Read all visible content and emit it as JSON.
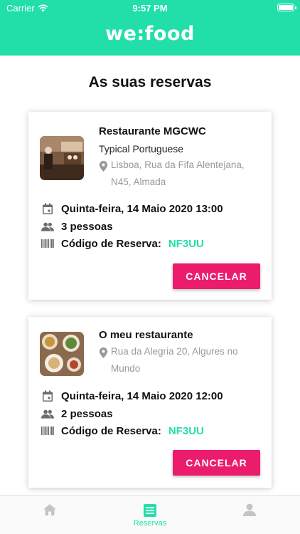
{
  "status_bar": {
    "carrier": "Carrier",
    "time": "9:57 PM"
  },
  "header": {
    "logo": "we:food"
  },
  "page": {
    "title": "As suas reservas"
  },
  "reservations": [
    {
      "restaurant": "Restaurante MGCWC",
      "cuisine": "Typical Portuguese",
      "address_line1": "Lisboa, Rua da Fifa Alentejana,",
      "address_line2": "N45, Almada",
      "datetime": "Quinta-feira, 14 Maio 2020 13:00",
      "people": "3 pessoas",
      "code_label": "Código de Reserva:",
      "code": "NF3UU",
      "cancel_label": "CANCELAR"
    },
    {
      "restaurant": "O meu restaurante",
      "address_line1": "Rua da Alegria 20, Algures no",
      "address_line2": "Mundo",
      "datetime": "Quinta-feira, 14 Maio 2020 12:00",
      "people": "2 pessoas",
      "code_label": "Código de Reserva:",
      "code": "NF3UU",
      "cancel_label": "CANCELAR"
    }
  ],
  "tabbar": {
    "items": [
      {
        "icon": "home-icon",
        "active": false
      },
      {
        "icon": "reservations-icon",
        "label": "Reservas",
        "active": true
      },
      {
        "icon": "profile-icon",
        "active": false
      }
    ]
  },
  "colors": {
    "brand": "#22dfaa",
    "cancel": "#ec1c6d",
    "muted": "#999999"
  }
}
